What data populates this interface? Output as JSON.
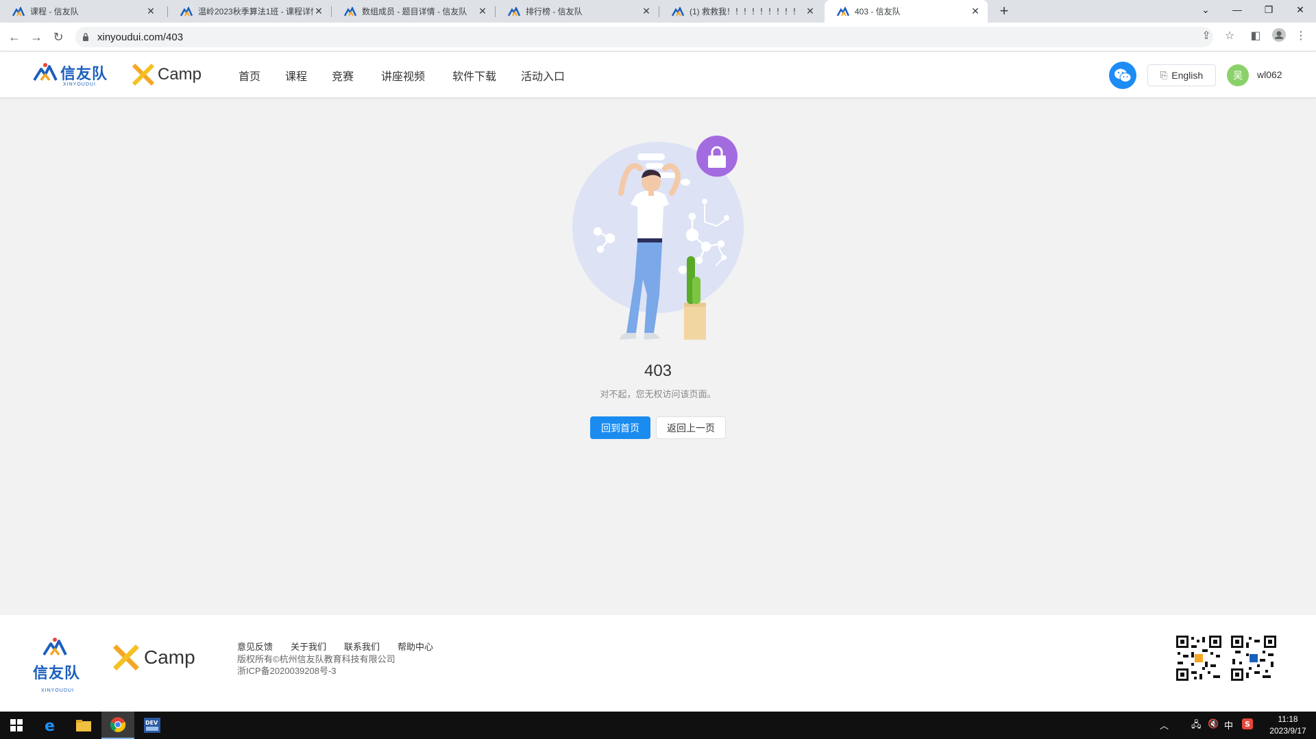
{
  "browser": {
    "tabs": [
      {
        "title": "课程 - 信友队",
        "active": false
      },
      {
        "title": "温岭2023秋季算法1班 - 课程详情",
        "active": false
      },
      {
        "title": "数组成员 - 题目详情 - 信友队",
        "active": false
      },
      {
        "title": "排行榜 - 信友队",
        "active": false
      },
      {
        "title": "(1) 救救我！！！！！！！！！",
        "active": false
      },
      {
        "title": "403 - 信友队",
        "active": true
      }
    ],
    "close_glyph": "✕",
    "new_tab_glyph": "+",
    "url": "xinyoudui.com/403"
  },
  "site": {
    "logo_text": "信友队",
    "logo_sub": "XINYOUDUI",
    "xcamp_text": "Camp",
    "nav": [
      "首页",
      "课程",
      "竞赛",
      "讲座视频",
      "软件下载",
      "活动入口"
    ],
    "lang_button": "English",
    "avatar_text": "吴",
    "username": "wl062"
  },
  "error": {
    "code": "403",
    "message": "对不起，您无权访问该页面。",
    "home_button": "回到首页",
    "back_button": "返回上一页"
  },
  "footer": {
    "links": [
      "意见反馈",
      "关于我们",
      "联系我们",
      "帮助中心"
    ],
    "copyright": "版权所有©杭州信友队教育科技有限公司",
    "icp": "浙ICP备2020039208号-3"
  },
  "taskbar": {
    "ime": "中",
    "time": "11:18",
    "date": "2023/9/17"
  },
  "colors": {
    "brand_blue": "#1b5fbd",
    "primary_button": "#1a8cf0",
    "lock_purple": "#a36be0"
  }
}
